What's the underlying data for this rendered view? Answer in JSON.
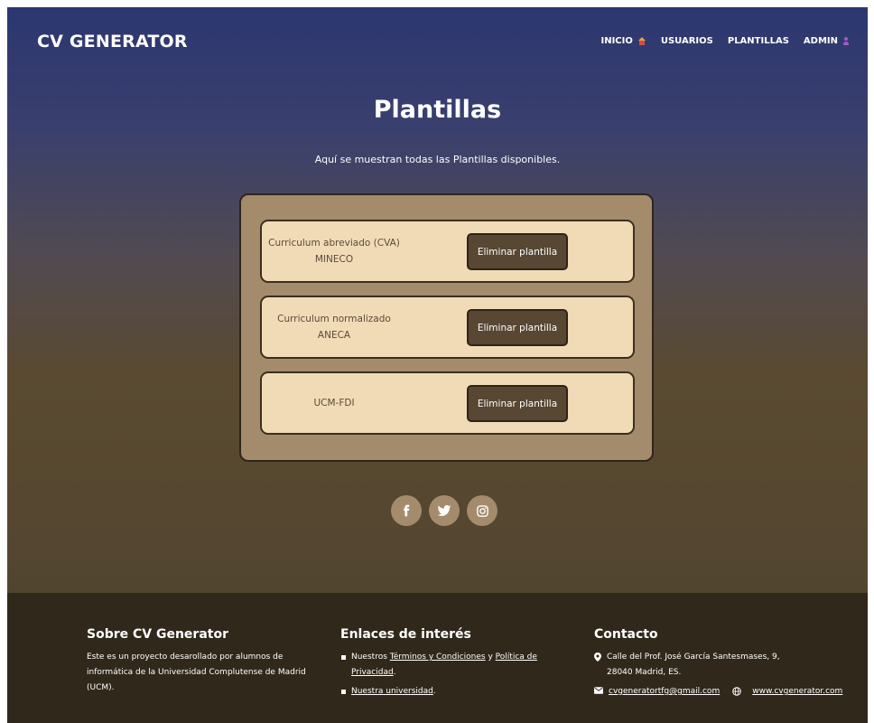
{
  "brand": "CV GENERATOR",
  "nav": [
    {
      "label": "INICIO",
      "icon": "house-icon"
    },
    {
      "label": "USUARIOS",
      "icon": ""
    },
    {
      "label": "PLANTILLAS",
      "icon": ""
    },
    {
      "label": "ADMIN",
      "icon": "person-icon"
    }
  ],
  "page": {
    "title": "Plantillas",
    "subtitle": "Aquí se muestran todas las Plantillas disponibles."
  },
  "templates": [
    {
      "name": "Curriculum abreviado (CVA) MINECO",
      "delete_label": "Eliminar plantilla"
    },
    {
      "name": "Curriculum normalizado ANECA",
      "delete_label": "Eliminar plantilla"
    },
    {
      "name": "UCM-FDI",
      "delete_label": "Eliminar plantilla"
    }
  ],
  "social": [
    "facebook-icon",
    "twitter-icon",
    "instagram-icon"
  ],
  "footer": {
    "about": {
      "title": "Sobre CV Generator",
      "text": "Este es un proyecto desarollado por alumnos de informática de la Universidad Complutense de Madrid (UCM)."
    },
    "links": {
      "title": "Enlaces de interés",
      "item1_prefix": "Nuestros ",
      "item1_link1": "Términos y Condiciones",
      "item1_middle": " y ",
      "item1_link2": "Política de Privacidad",
      "item1_suffix": ".",
      "item2_link": "Nuestra universidad",
      "item2_suffix": "."
    },
    "contact": {
      "title": "Contacto",
      "address_line1": "Calle del Prof. José García Santesmases, 9,",
      "address_line2": "28040 Madrid, ES.",
      "email": "cvgeneratortfg@gmail.com",
      "website": "www.cvgenerator.com"
    }
  },
  "colors": {
    "panel": "#a38b6c",
    "card": "#f1dbb7",
    "button": "#574733",
    "footer": "#30281a",
    "header_top": "#2c3770"
  }
}
